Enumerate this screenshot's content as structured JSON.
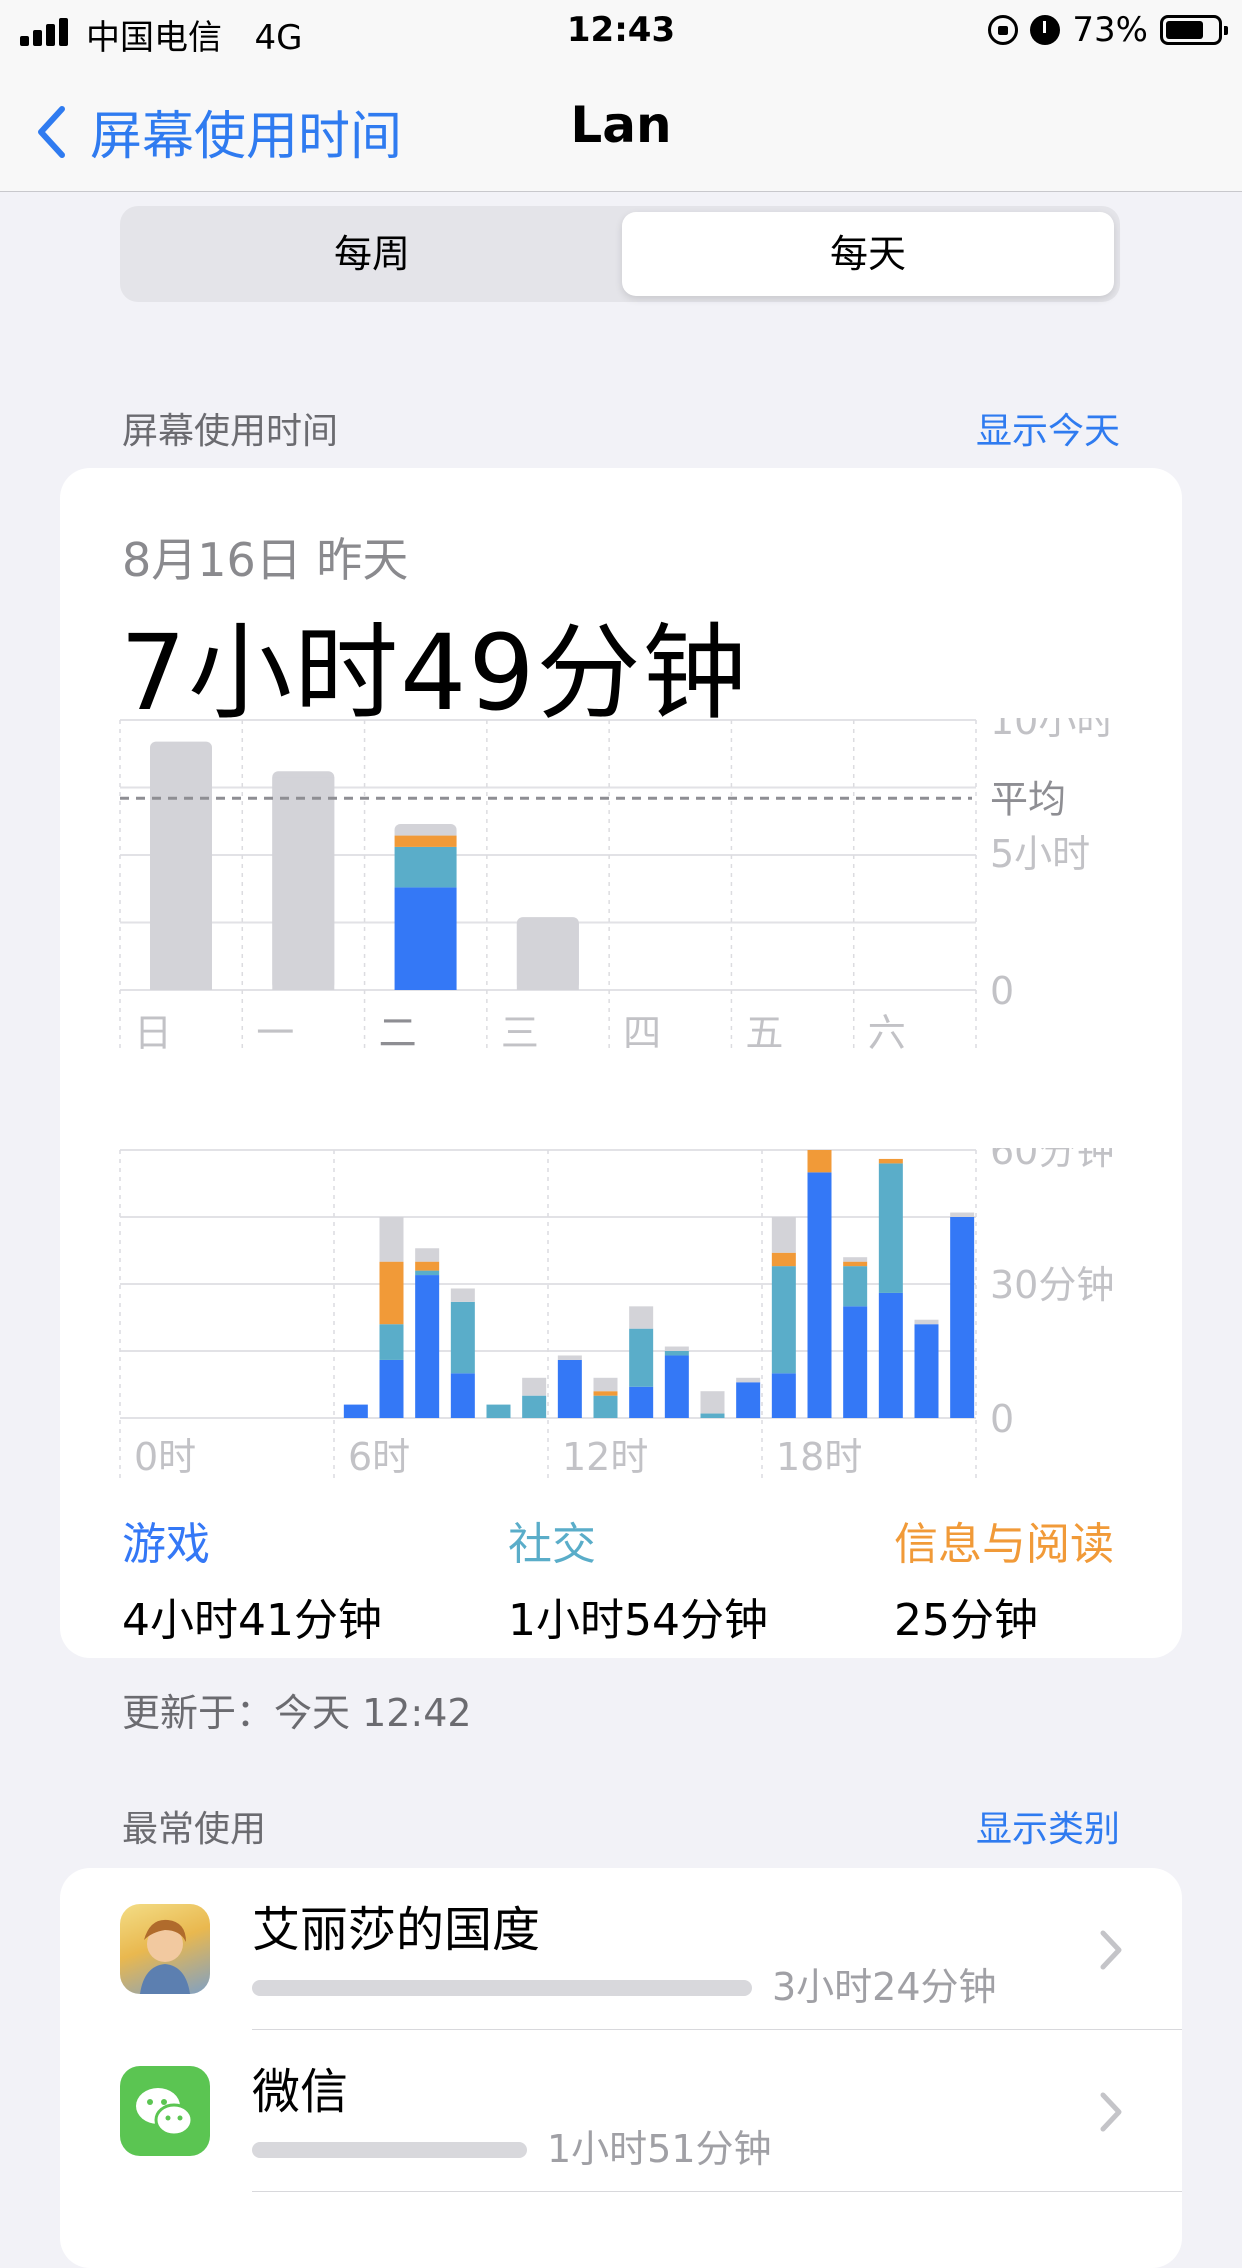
{
  "status": {
    "carrier": "中国电信",
    "network": "4G",
    "time": "12:43",
    "battery_text": "73%",
    "battery_level": 0.73
  },
  "nav": {
    "back_label": "屏幕使用时间",
    "title": "Lan"
  },
  "segment": {
    "weekly": "每周",
    "daily": "每天",
    "selected": "每天"
  },
  "screen_time": {
    "header": "屏幕使用时间",
    "show_today": "显示今天",
    "date": "8月16日 昨天",
    "total": "7小时49分钟",
    "updated": "更新于：今天 12:42"
  },
  "colors": {
    "game": "#3478f6",
    "social": "#5aadc9",
    "reading": "#f19a38",
    "other": "#d3d3d8",
    "link": "#2f7bf0"
  },
  "chart_data": [
    {
      "type": "bar",
      "categories": [
        "日",
        "一",
        "二",
        "三",
        "四",
        "五",
        "六"
      ],
      "series": [
        {
          "values": [
            null,
            null,
            3.8,
            null,
            null,
            null,
            null
          ]
        },
        {
          "values": [
            null,
            null,
            1.5,
            null,
            null,
            null,
            null
          ]
        },
        {
          "values": [
            null,
            null,
            0.42,
            null,
            null,
            null,
            null
          ]
        },
        {
          "values": [
            9.2,
            8.1,
            0.43,
            2.7,
            0,
            0,
            0
          ]
        }
      ],
      "ylim": [
        0,
        10
      ],
      "y_ticks": [
        "10小时",
        "5小时",
        "0"
      ],
      "average_value": 7.1,
      "average_label": "平均",
      "highlight_index": 2
    },
    {
      "type": "bar",
      "x": [
        "0时",
        "6时",
        "12时",
        "18时"
      ],
      "hours": [
        0,
        1,
        2,
        3,
        4,
        5,
        6,
        7,
        8,
        9,
        10,
        11,
        12,
        13,
        14,
        15,
        16,
        17,
        18,
        19,
        20,
        21,
        22,
        23
      ],
      "series": [
        {
          "values": [
            0,
            0,
            0,
            0,
            0,
            0,
            0,
            3,
            13,
            32,
            10,
            0,
            0,
            13,
            0,
            7,
            14,
            0,
            8,
            10,
            55,
            25,
            28,
            21,
            45
          ]
        },
        {
          "values": [
            1,
            0,
            0,
            0,
            0,
            0,
            0,
            0,
            8,
            1,
            16,
            3,
            5,
            0,
            5,
            13,
            1,
            1,
            0,
            24,
            0,
            9,
            29,
            0,
            0
          ]
        },
        {
          "values": [
            0,
            0,
            0,
            0,
            0,
            0,
            0,
            0,
            14,
            2,
            0,
            0,
            0,
            0,
            1,
            0,
            0,
            0,
            0,
            3,
            5,
            1,
            1,
            0,
            0
          ]
        },
        {
          "values": [
            0,
            0,
            0,
            0,
            0,
            0,
            0,
            0,
            10,
            3,
            3,
            0,
            4,
            1,
            3,
            5,
            1,
            5,
            1,
            8,
            0,
            1,
            0,
            1,
            1
          ]
        }
      ],
      "ylim": [
        0,
        60
      ],
      "y_ticks": [
        "60分钟",
        "30分钟",
        "0"
      ]
    }
  ],
  "categories": [
    {
      "name": "游戏",
      "value": "4小时41分钟",
      "color": "#3478f6"
    },
    {
      "name": "社交",
      "value": "1小时54分钟",
      "color": "#5aadc9"
    },
    {
      "name": "信息与阅读",
      "value": "25分钟",
      "color": "#f19a38"
    }
  ],
  "most_used": {
    "header": "最常使用",
    "show_categories": "显示类别",
    "apps": [
      {
        "name": "艾丽莎的国度",
        "time": "3小时24分钟",
        "share": 1.0,
        "icon": "game-app-icon"
      },
      {
        "name": "微信",
        "time": "1小时51分钟",
        "share": 0.55,
        "icon": "wechat-icon"
      }
    ]
  }
}
